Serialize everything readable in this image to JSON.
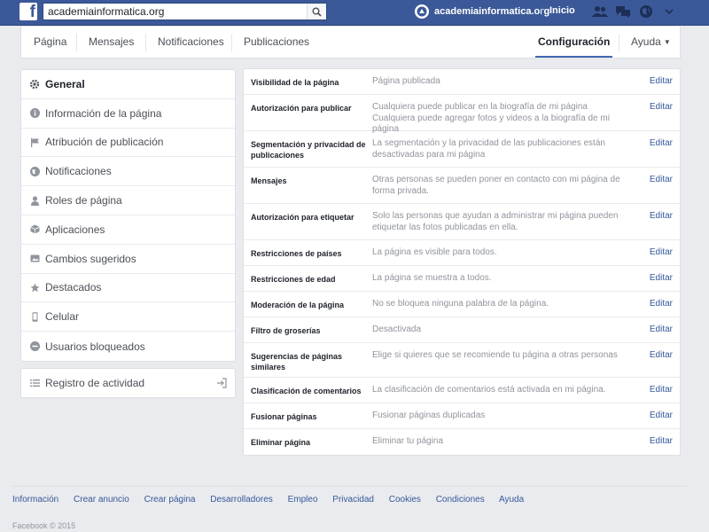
{
  "topbar": {
    "logo_letter": "f",
    "search_value": "academiainformatica.org",
    "page_name": "academiainformatica.org",
    "home_label": "Inicio",
    "icons": [
      "friends-icon",
      "messages-icon",
      "globe-icon",
      "settings-caret-icon"
    ]
  },
  "subnav": {
    "tabs": [
      {
        "label": "Página"
      },
      {
        "label": "Mensajes"
      },
      {
        "label": "Notificaciones"
      },
      {
        "label": "Publicaciones"
      }
    ],
    "settings_label": "Configuración",
    "help_label": "Ayuda"
  },
  "sidebar": {
    "items": [
      {
        "label": "General",
        "icon": "gear-icon"
      },
      {
        "label": "Información de la página",
        "icon": "info-icon"
      },
      {
        "label": "Atribución de publicación",
        "icon": "flag-icon"
      },
      {
        "label": "Notificaciones",
        "icon": "globe-icon"
      },
      {
        "label": "Roles de página",
        "icon": "person-icon"
      },
      {
        "label": "Aplicaciones",
        "icon": "cube-icon"
      },
      {
        "label": "Cambios sugeridos",
        "icon": "image-icon"
      },
      {
        "label": "Destacados",
        "icon": "star-icon"
      },
      {
        "label": "Celular",
        "icon": "mobile-icon"
      },
      {
        "label": "Usuarios bloqueados",
        "icon": "blocked-icon"
      }
    ],
    "activity_label": "Registro de actividad"
  },
  "settings": {
    "edit_label": "Editar",
    "rows": [
      {
        "label": "Visibilidad de la página",
        "value": "Página publicada"
      },
      {
        "label": "Autorización para publicar",
        "value": "Cualquiera puede publicar en la biografía de mi página\nCualquiera puede agregar fotos y videos a la biografía de mi página"
      },
      {
        "label": "Segmentación y privacidad de publicaciones",
        "value": "La segmentación y la privacidad de las publicaciones están desactivadas para mi página"
      },
      {
        "label": "Mensajes",
        "value": "Otras personas se pueden poner en contacto con mi página de forma privada."
      },
      {
        "label": "Autorización para etiquetar",
        "value": "Solo las personas que ayudan a administrar mi página pueden etiquetar las fotos publicadas en ella."
      },
      {
        "label": "Restricciones de países",
        "value": "La página es visible para todos."
      },
      {
        "label": "Restricciones de edad",
        "value": "La página se muestra a todos."
      },
      {
        "label": "Moderación de la página",
        "value": "No se bloquea ninguna palabra de la página."
      },
      {
        "label": "Filtro de groserías",
        "value": "Desactivada"
      },
      {
        "label": "Sugerencias de páginas similares",
        "value": "Elige si quieres que se recomiende tu página a otras personas"
      },
      {
        "label": "Clasificación de comentarios",
        "value": "La clasificación de comentarios está activada en mi página."
      },
      {
        "label": "Fusionar páginas",
        "value": "Fusionar páginas duplicadas"
      },
      {
        "label": "Eliminar página",
        "value": "Eliminar tu página"
      }
    ]
  },
  "footer": {
    "links": [
      "Información",
      "Crear anuncio",
      "Crear página",
      "Desarrolladores",
      "Empleo",
      "Privacidad",
      "Cookies",
      "Condiciones",
      "Ayuda"
    ],
    "copyright": "Facebook © 2015"
  },
  "colors": {
    "brand_blue": "#3b5998",
    "link_blue": "#365899",
    "background": "#e9ebee"
  }
}
